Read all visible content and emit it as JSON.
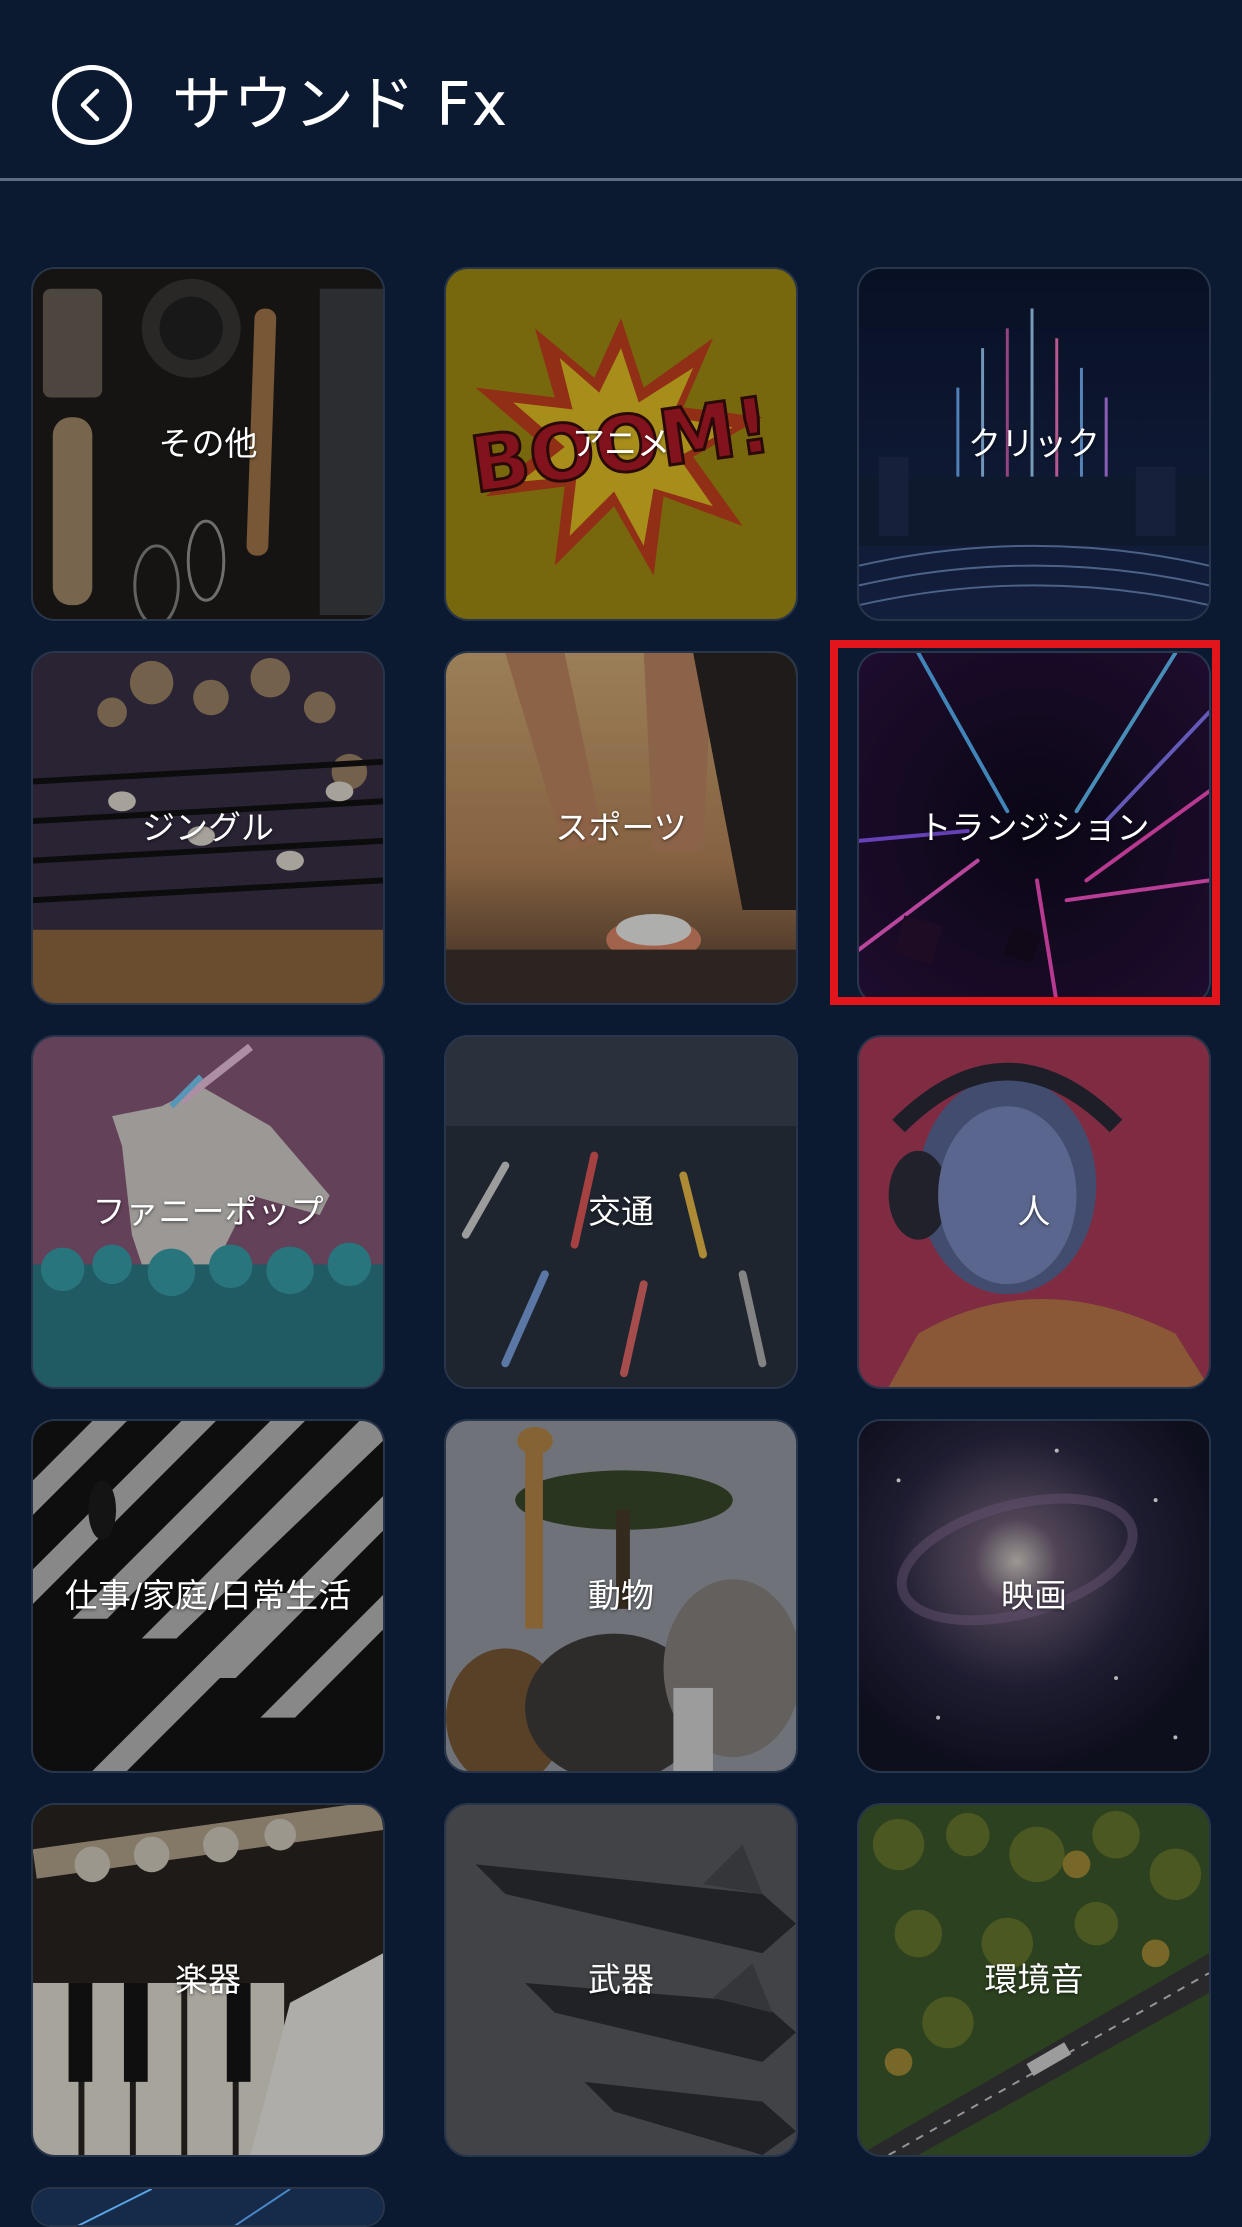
{
  "header": {
    "back_icon": "chevron-left-circle-icon",
    "title": "サウンド Fx"
  },
  "colors": {
    "background": "#0b1a31",
    "divider": "#5d6c80",
    "highlight": "#e2141c"
  },
  "categories": [
    {
      "label": "その他",
      "image": "kitchen-utensils"
    },
    {
      "label": "アニメ",
      "image": "comic-boom"
    },
    {
      "label": "クリック",
      "image": "neon-city-equalizer"
    },
    {
      "label": "ジングル",
      "image": "music-notes-bokeh"
    },
    {
      "label": "スポーツ",
      "image": "runner-shoes"
    },
    {
      "label": "トランジション",
      "image": "neon-light-tunnel",
      "highlighted": true
    },
    {
      "label": "ファニーポップ",
      "image": "unicorn-horse"
    },
    {
      "label": "交通",
      "image": "city-traffic-blur"
    },
    {
      "label": "人",
      "image": "woman-headphones"
    },
    {
      "label": "仕事/家庭/日常生活",
      "image": "crosswalk-walker"
    },
    {
      "label": "動物",
      "image": "safari-animals"
    },
    {
      "label": "映画",
      "image": "galaxy-space"
    },
    {
      "label": "楽器",
      "image": "flute-piano"
    },
    {
      "label": "武器",
      "image": "missiles"
    },
    {
      "label": "環境音",
      "image": "forest-road-aerial"
    }
  ]
}
